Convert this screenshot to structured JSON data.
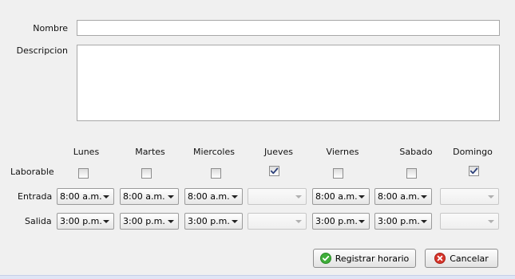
{
  "form": {
    "nombre_label": "Nombre",
    "nombre_value": "",
    "descripcion_label": "Descripcion",
    "descripcion_value": ""
  },
  "schedule": {
    "row_labels": {
      "laborable": "Laborable",
      "entrada": "Entrada",
      "salida": "Salida"
    },
    "days": [
      {
        "name": "Lunes",
        "laborable": false,
        "entrada": "8:00 a.m.",
        "salida": "3:00 p.m.",
        "enabled": true
      },
      {
        "name": "Martes",
        "laborable": false,
        "entrada": "8:00 a.m.",
        "salida": "3:00 p.m.",
        "enabled": true
      },
      {
        "name": "Miercoles",
        "laborable": false,
        "entrada": "8:00 a.m.",
        "salida": "3:00 p.m.",
        "enabled": true
      },
      {
        "name": "Jueves",
        "laborable": true,
        "entrada": "",
        "salida": "",
        "enabled": false
      },
      {
        "name": "Viernes",
        "laborable": false,
        "entrada": "8:00 a.m.",
        "salida": "3:00 p.m.",
        "enabled": true
      },
      {
        "name": "Sabado",
        "laborable": false,
        "entrada": "8:00 a.m.",
        "salida": "3:00 p.m.",
        "enabled": true
      },
      {
        "name": "Domingo",
        "laborable": true,
        "entrada": "",
        "salida": "",
        "enabled": false
      }
    ]
  },
  "buttons": {
    "registrar_label": "Registrar horario",
    "cancelar_label": "Cancelar",
    "registrar_icon": "check-circle-icon",
    "cancelar_icon": "x-circle-icon",
    "registrar_icon_color": "#3fae3a",
    "cancelar_icon_color": "#d6352b"
  }
}
